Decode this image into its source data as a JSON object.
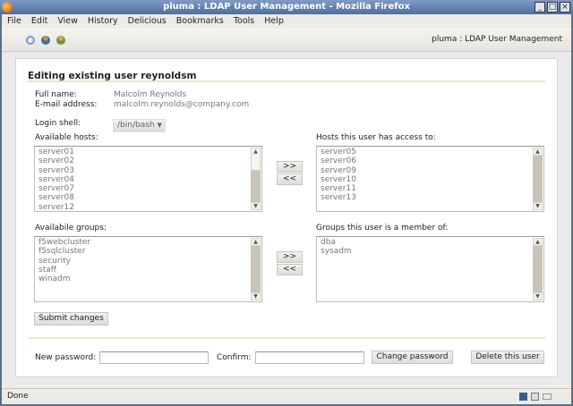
{
  "window": {
    "title": "pluma : LDAP User Management - Mozilla Firefox"
  },
  "menu": [
    "File",
    "Edit",
    "View",
    "History",
    "Delicious",
    "Bookmarks",
    "Tools",
    "Help"
  ],
  "toolbar": {
    "breadcrumb": "pluma  :  LDAP User Management",
    "icons": [
      "search-icon",
      "user-icon",
      "users-icon"
    ]
  },
  "form": {
    "heading": "Editing existing user reynoldsm",
    "full_name_label": "Full name:",
    "full_name": "Malcolm Reynolds",
    "email_label": "E-mail address:",
    "email": "malcolm.reynolds@company.com",
    "shell_label": "Login shell:",
    "shell": "/bin/bash",
    "available_hosts_label": "Available hosts:",
    "available_hosts": [
      "server01",
      "server02",
      "server03",
      "server04",
      "server07",
      "server08",
      "server12"
    ],
    "user_hosts_label": "Hosts this user has access to:",
    "user_hosts": [
      "server05",
      "server06",
      "server09",
      "server10",
      "server11",
      "server13"
    ],
    "available_groups_label": "Availabile groups:",
    "available_groups": [
      "f5webcluster",
      "f5sqlcluster",
      "security",
      "staff",
      "winadm"
    ],
    "user_groups_label": "Groups this user is a member of:",
    "user_groups": [
      "dba",
      "sysadm"
    ],
    "add_label": ">>",
    "remove_label": "<<",
    "submit": "Submit changes",
    "new_password_label": "New password:",
    "new_password": "",
    "confirm_label": "Confirm:",
    "confirm": "",
    "change_password": "Change password",
    "delete_user": "Delete this user"
  },
  "status": {
    "text": "Done"
  }
}
